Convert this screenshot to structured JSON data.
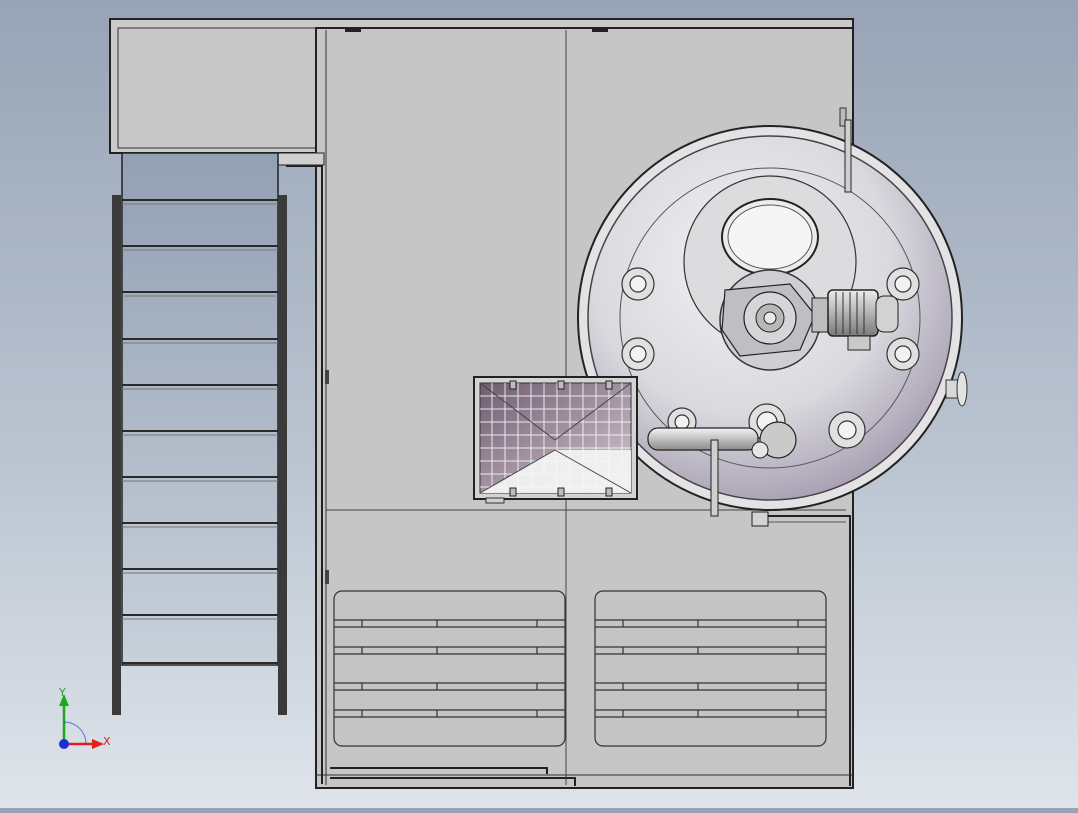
{
  "viewport": {
    "background_top": "#98a4b6",
    "background_bottom": "#dfe4ea",
    "model_fill": "#c9c9c9",
    "edge_color": "#2a2a2a"
  },
  "triad": {
    "x_label": "X",
    "y_label": "Y",
    "x_color": "#e0201b",
    "y_color": "#1ea81e",
    "z_color": "#1c2fd6"
  },
  "model": {
    "stair_treads": 10,
    "grid_cells_visible": true
  }
}
